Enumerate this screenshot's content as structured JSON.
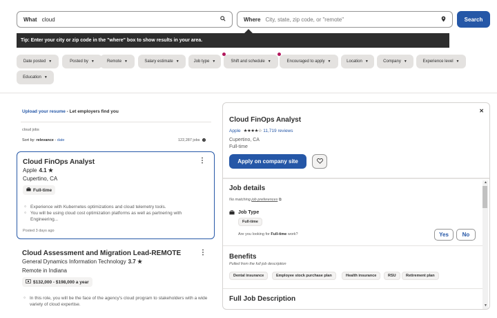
{
  "search": {
    "what_label": "What",
    "what_value": "cloud",
    "where_label": "Where",
    "where_placeholder": "City, state, zip code, or \"remote\"",
    "button": "Search",
    "search_icon": "search-icon",
    "location_icon": "location-pin-icon"
  },
  "tip": "Tip: Enter your city or zip code in the \"where\" box to show results in your area.",
  "filters": [
    {
      "label": "Date posted"
    },
    {
      "label": "Posted by"
    },
    {
      "label": "Remote"
    },
    {
      "label": "Salary estimate"
    },
    {
      "label": "Job type"
    },
    {
      "label": "Shift and schedule"
    },
    {
      "label": "Encouraged to apply"
    },
    {
      "label": "Location"
    },
    {
      "label": "Company"
    },
    {
      "label": "Experience level"
    },
    {
      "label": "Education"
    }
  ],
  "results": {
    "upload_link": "Upload your resume",
    "upload_rest": " - Let employers find you",
    "breadcrumb": "cloud jobs",
    "sort_prefix": "Sort by: ",
    "sort_active": "relevance",
    "sort_sep": " - ",
    "sort_other": "date",
    "count": "122,287 jobs"
  },
  "jobs": [
    {
      "title": "Cloud FinOps Analyst",
      "company": "Apple",
      "rating": "4.1 ★",
      "location": "Cupertino, CA",
      "tag": "Full-time",
      "bullet1": "Experience with Kubernetes optimizations and cloud telemetry tools.",
      "bullet2": "You will be using cloud cost optimization platforms as well as partnering with Engineering...",
      "posted": "Posted 3 days ago"
    },
    {
      "title": "Cloud Assessment and Migration Lead-REMOTE",
      "company": "General Dynamics Information Technology",
      "rating": "3.7 ★",
      "location": "Remote in Indiana",
      "tag": "$132,000 - $198,000 a year",
      "bullet1": "In this role, you will be the face of the agency's cloud program to stakeholders with a wide variety of cloud expertise."
    }
  ],
  "detail": {
    "title": "Cloud FinOps Analyst",
    "company": "Apple",
    "stars": "★★★★☆",
    "reviews": "11,719 reviews",
    "location": "Cupertino, CA",
    "type": "Full-time",
    "apply": "Apply on company site",
    "job_details_h": "Job details",
    "no_matching": "No matching ",
    "job_prefs": "job preferences",
    "job_type_label": "Job Type",
    "job_type_pill": "Full-time",
    "question_prefix": "Are you looking for ",
    "question_bold": "Full-time",
    "question_suffix": " work?",
    "yes": "Yes",
    "no": "No",
    "benefits_h": "Benefits",
    "benefits_sub": "Pulled from the full job description",
    "benefits": [
      "Dental insurance",
      "Employee stock purchase plan",
      "Health insurance",
      "RSU",
      "Retirement plan"
    ],
    "full_desc_h": "Full Job Description"
  }
}
